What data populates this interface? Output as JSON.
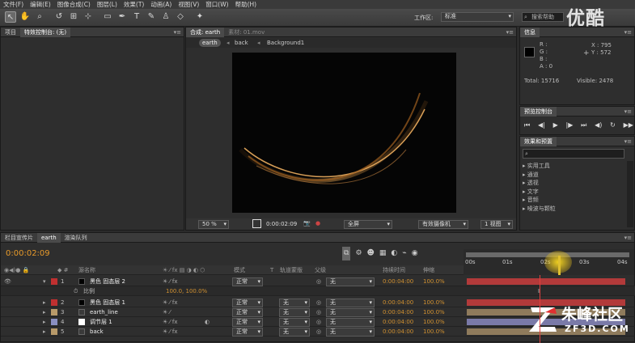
{
  "menubar": {
    "items": [
      "文件(F)",
      "编辑(E)",
      "图像合成(C)",
      "图层(L)",
      "效果(T)",
      "动画(A)",
      "视图(V)",
      "窗口(W)",
      "帮助(H)"
    ]
  },
  "toolbar": {
    "workspace_label": "工作区:",
    "workspace_value": "标准",
    "search_placeholder": "搜索帮助"
  },
  "watermark": {
    "top": "优酷",
    "site_name": "朱峰社区",
    "site_url": "ZF3D.COM"
  },
  "project_panel": {
    "tab_project": "项目",
    "tab_effect_controls": "特效控制台: (无)"
  },
  "comp_panel": {
    "tab_comp": "合成: earth",
    "tab_footage": "素材: 01.mov",
    "breadcrumbs": [
      "earth",
      "back",
      "Background1"
    ],
    "zoom": "50 %",
    "timecode": "0:00:02:09",
    "resolution": "全屏",
    "camera": "有效摄像机",
    "views": "1 视图"
  },
  "info_panel": {
    "tab": "信息",
    "r": "R :",
    "g": "G :",
    "b": "B :",
    "a": "A : 0",
    "x": "X : 795",
    "y": "Y : 572",
    "total": "Total: 15716",
    "visible": "Visible: 2478"
  },
  "preview_panel": {
    "tab": "预览控制台"
  },
  "effects_panel": {
    "tab": "效果和预置",
    "categories": [
      "实用工具",
      "通道",
      "透视",
      "文字",
      "音频",
      "噪波与颗粒"
    ]
  },
  "timeline": {
    "tabs": [
      "栏目宣传片",
      "earth",
      "渲染队列"
    ],
    "timecode": "0:00:02:09",
    "col_source": "源名称",
    "col_mode": "模式",
    "col_t": "T",
    "col_trackmat": "轨道蒙版",
    "col_parent": "父级",
    "col_duration": "持续时间",
    "col_stretch": "伸缩",
    "ruler": [
      "00s",
      "01s",
      "02s",
      "03s",
      "04s"
    ],
    "layers": [
      {
        "num": "1",
        "name": "黑色 固态层 2",
        "mode": "正常",
        "trackmat": "",
        "parent": "无",
        "duration": "0:00:04:00",
        "stretch": "100.0%",
        "color": "#c03030",
        "bar": "#b23a3a"
      },
      {
        "num": "2",
        "name": "黑色 固态层 1",
        "mode": "正常",
        "trackmat": "无",
        "parent": "无",
        "duration": "0:00:04:00",
        "stretch": "100.0%",
        "color": "#c03030",
        "bar": "#b23a3a"
      },
      {
        "num": "3",
        "name": "earth_line",
        "mode": "正常",
        "trackmat": "无",
        "parent": "无",
        "duration": "0:00:04:00",
        "stretch": "100.0%",
        "color": "#b89a6a",
        "bar": "#8f7b5c"
      },
      {
        "num": "4",
        "name": "调节层 1",
        "mode": "正常",
        "trackmat": "无",
        "parent": "无",
        "duration": "0:00:04:00",
        "stretch": "100.0%",
        "color": "#8a8fc0",
        "bar": "#7a7aa8"
      },
      {
        "num": "5",
        "name": "back",
        "mode": "正常",
        "trackmat": "无",
        "parent": "无",
        "duration": "0:00:04:00",
        "stretch": "100.0%",
        "color": "#b89a6a",
        "bar": "#8f7b5c"
      }
    ],
    "scale_label": "比例",
    "scale_value": "100.0, 100.0%"
  }
}
